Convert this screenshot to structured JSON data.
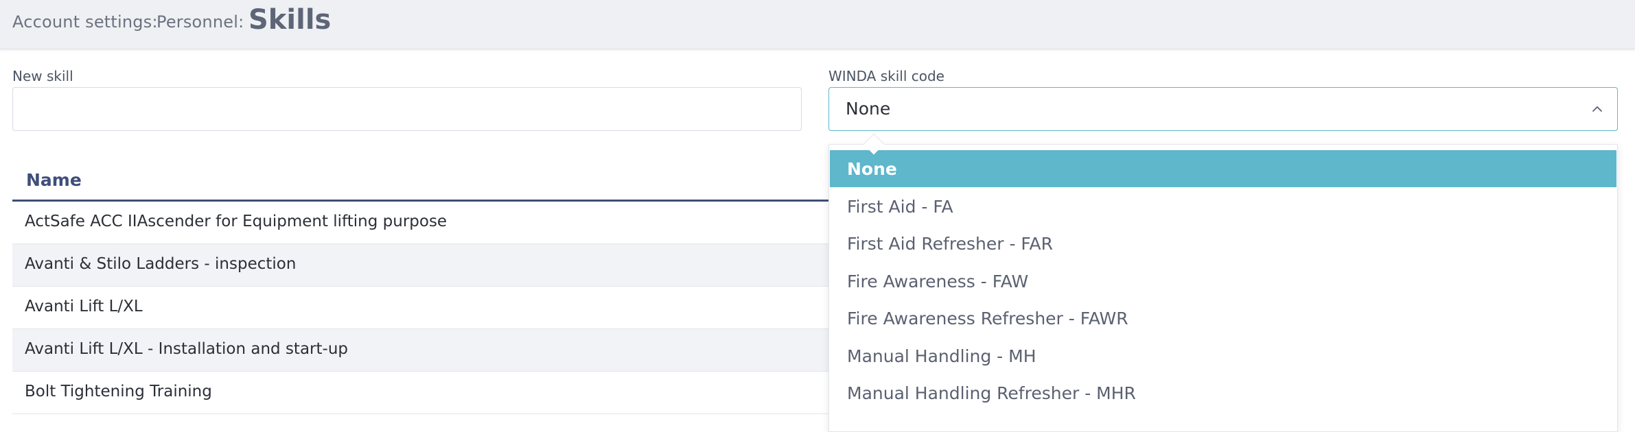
{
  "header": {
    "crumb_account": "Account settings:",
    "crumb_personnel": "Personnel:",
    "title": "Skills"
  },
  "form": {
    "new_skill_label": "New skill",
    "new_skill_value": "",
    "winda_label": "WINDA skill code",
    "winda_value": "None",
    "chevron_icon": "chevron-up-icon"
  },
  "table": {
    "column_name": "Name",
    "rows": [
      "ActSafe ACC IIAscender for Equipment lifting purpose",
      "Avanti & Stilo Ladders - inspection",
      "Avanti Lift L/XL",
      "Avanti Lift L/XL - Installation and start-up",
      "Bolt Tightening Training"
    ]
  },
  "dropdown": {
    "options": [
      "None",
      "First Aid - FA",
      "First Aid Refresher - FAR",
      "Fire Awareness - FAW",
      "Fire Awareness Refresher - FAWR",
      "Manual Handling - MH",
      "Manual Handling Refresher - MHR"
    ],
    "selected": "None"
  },
  "colors": {
    "accent": "#5eb7cb",
    "header_bg": "#eef0f3",
    "table_header": "#3f4e7a"
  }
}
